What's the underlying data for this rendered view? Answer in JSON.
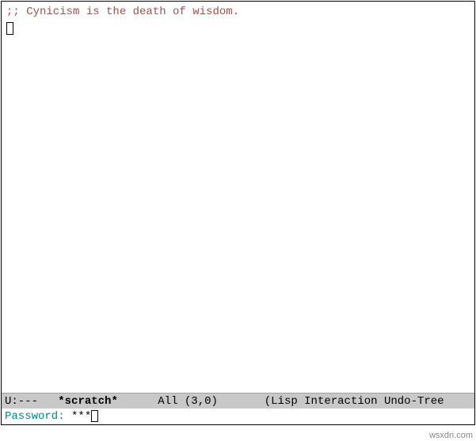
{
  "buffer": {
    "comment_line": ";; Cynicism is the death of wisdom."
  },
  "modeline": {
    "status": "U:---",
    "buffer_name": "*scratch*",
    "position": "All",
    "coords": "(3,0)",
    "modes": "(Lisp Interaction Undo-Tree"
  },
  "minibuffer": {
    "prompt": "Password: ",
    "masked_value": "***"
  },
  "watermark": "wsxdn.com"
}
